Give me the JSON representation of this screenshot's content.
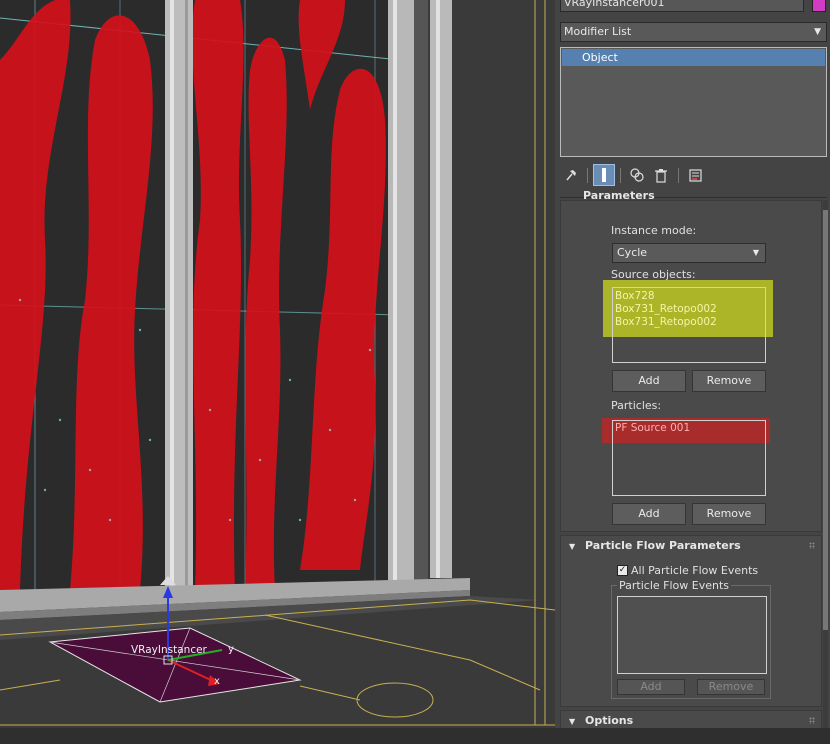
{
  "object": {
    "name": "VRayInstancer001",
    "color": "#d23cc3"
  },
  "modifier_list": {
    "label": "Modifier List",
    "stack_items": [
      "Object"
    ]
  },
  "toolbar": {
    "icons": [
      "pin-stack-icon",
      "show-end-result-icon",
      "make-unique-icon",
      "remove-modifier-icon",
      "configure-modifier-sets-icon"
    ]
  },
  "parameters": {
    "title": "Parameters",
    "instance_mode_label": "Instance mode:",
    "instance_mode_value": "Cycle",
    "source_objects_label": "Source objects:",
    "source_objects": [
      "Box728",
      "Box731_Retopo002",
      "Box731_Retopo002"
    ],
    "add_label": "Add",
    "remove_label": "Remove",
    "particles_label": "Particles:",
    "particles": [
      "PF Source 001"
    ],
    "add2_label": "Add",
    "remove2_label": "Remove"
  },
  "particle_flow": {
    "title": "Particle Flow Parameters",
    "all_events_label": "All Particle Flow Events",
    "all_events_checked": true,
    "events_group_label": "Particle Flow Events",
    "add_label": "Add",
    "remove_label": "Remove"
  },
  "options": {
    "title": "Options"
  },
  "viewport": {
    "object_label": "VRayInstancer",
    "axis_x": "x",
    "axis_y": "y"
  },
  "colors": {
    "highlight_yellow": "#c8d21e",
    "highlight_red": "#c82323",
    "selection_blue": "#5680b0",
    "particles_red": "#d4101a"
  }
}
